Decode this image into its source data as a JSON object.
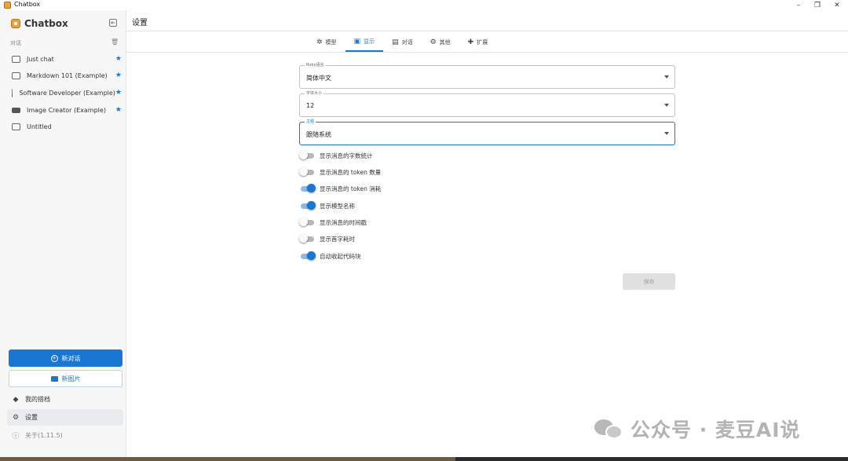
{
  "window": {
    "title": "Chatbox",
    "minimize": "–",
    "maximize": "❐",
    "close": "✕"
  },
  "sidebar": {
    "brand": "Chatbox",
    "collapse_icon": "⇤",
    "section_label": "对话",
    "trash_icon": "🗑",
    "sessions": [
      {
        "label": "Just chat",
        "starred": "★",
        "icon": "chat-bubble-icon"
      },
      {
        "label": "Markdown 101 (Example)",
        "starred": "★",
        "icon": "chat-bubble-icon"
      },
      {
        "label": "Software Developer (Example)",
        "starred": "★",
        "icon": "developer-avatar-icon"
      },
      {
        "label": "Image Creator (Example)",
        "starred": "★",
        "icon": "image-icon"
      },
      {
        "label": "Untitled",
        "starred": "",
        "icon": "chat-bubble-icon"
      }
    ],
    "new_chat": "新对话",
    "new_image": "新图片",
    "links": [
      {
        "label": "我的搭档",
        "icon": "◆"
      },
      {
        "label": "设置",
        "icon": "⚙"
      },
      {
        "label": "关于(1.11.5)",
        "icon": "ⓘ"
      }
    ]
  },
  "main": {
    "title": "设置",
    "tabs": [
      {
        "label": "模型",
        "icon": "✲"
      },
      {
        "label": "显示",
        "icon": "▣"
      },
      {
        "label": "对话",
        "icon": "▤"
      },
      {
        "label": "其他",
        "icon": "⚙"
      },
      {
        "label": "扩展",
        "icon": "✚"
      }
    ],
    "active_tab": "显示",
    "fields": {
      "language": {
        "label": "Ruby语言",
        "value": "简体中文"
      },
      "font_size": {
        "label": "字体大小",
        "value": "12"
      },
      "theme": {
        "label": "主题",
        "value": "跟随系统"
      }
    },
    "toggles": [
      {
        "label": "显示消息的字数统计",
        "on": false
      },
      {
        "label": "显示消息的 token 数量",
        "on": false
      },
      {
        "label": "显示消息的 token 消耗",
        "on": true
      },
      {
        "label": "显示模型名称",
        "on": true
      },
      {
        "label": "显示消息的时间戳",
        "on": false
      },
      {
        "label": "显示首字耗时",
        "on": false
      },
      {
        "label": "自动收起代码块",
        "on": true
      }
    ],
    "save": "保存"
  },
  "watermark": {
    "text": "公众号 · 麦豆AI说"
  },
  "colors": {
    "accent": "#1976d2",
    "sidebar_bg": "#f7f7f7",
    "disabled": "#e0e0e0"
  }
}
